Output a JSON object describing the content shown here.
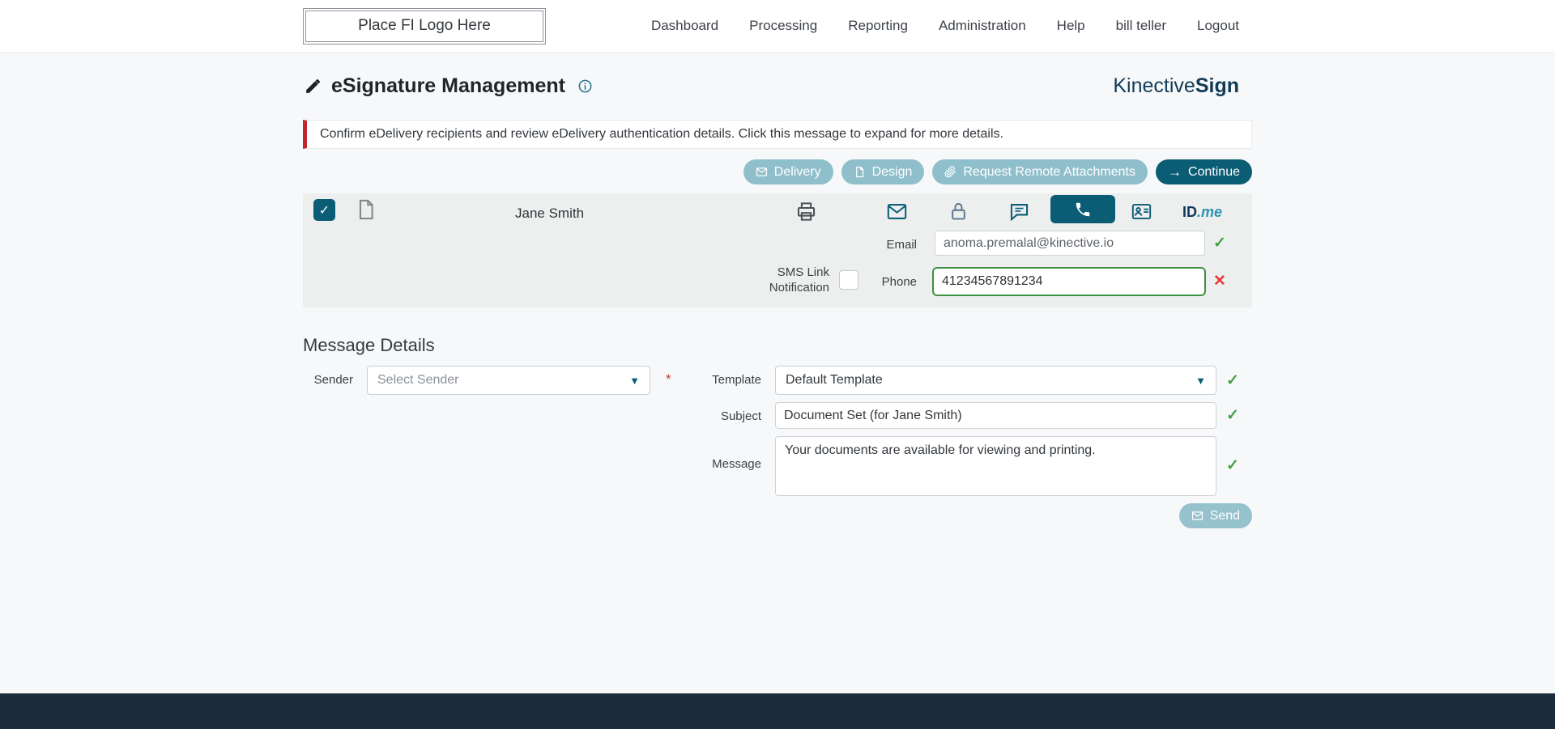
{
  "nav": {
    "logo_text": "Place FI Logo Here",
    "items": [
      "Dashboard",
      "Processing",
      "Reporting",
      "Administration",
      "Help",
      "bill teller",
      "Logout"
    ]
  },
  "header": {
    "title": "eSignature Management",
    "brand_first": "Kinective",
    "brand_second": "Sign"
  },
  "alert": {
    "text": "Confirm eDelivery recipients and review eDelivery authentication details. Click this message to expand for more details."
  },
  "toolbar": {
    "delivery_label": "Delivery",
    "design_label": "Design",
    "request_remote_attachments_label": "Request Remote Attachments",
    "continue_label": "Continue"
  },
  "recipient": {
    "name": "Jane Smith",
    "idme_part1": "ID",
    "idme_part2": ".me",
    "email_label": "Email",
    "email_value": "anoma.premalal@kinective.io",
    "sms_link_label": "SMS Link Notification",
    "phone_label": "Phone",
    "phone_value": "41234567891234"
  },
  "message_details": {
    "heading": "Message Details",
    "sender_label": "Sender",
    "sender_value": "Select Sender",
    "required_marker": "*",
    "template_label": "Template",
    "template_value": "Default Template",
    "subject_label": "Subject",
    "subject_value": "Document Set (for Jane Smith)",
    "message_label": "Message",
    "message_value": "Your documents are available for viewing and printing.",
    "send_label": "Send"
  },
  "icons": {
    "check": "✓",
    "cross": "✕",
    "arrow_right": "→",
    "caret": "▼"
  },
  "colors": {
    "primary_teal": "#0b5c75",
    "light_teal": "#8fbfcb",
    "success_green": "#43a047",
    "error_red": "#e53935",
    "alert_red": "#c1272d",
    "brand_navy": "#123b57",
    "footer_navy": "#1d2c3c"
  }
}
